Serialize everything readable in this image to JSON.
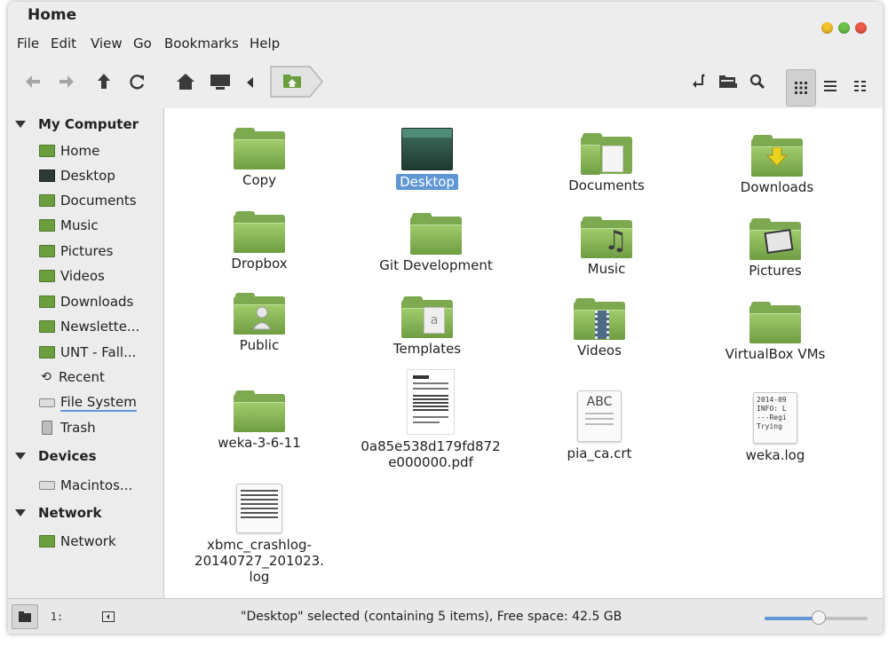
{
  "window": {
    "title": "Home"
  },
  "menu": [
    "File",
    "Edit",
    "View",
    "Go",
    "Bookmarks",
    "Help"
  ],
  "toolbar": {
    "nav_icons": [
      "back-arrow-icon",
      "forward-arrow-icon",
      "up-arrow-icon",
      "reload-icon"
    ],
    "place_icons": [
      "home-icon",
      "computer-icon"
    ],
    "breadcrumb_icon": "home-folder-icon",
    "right_icons": [
      "open-terminal-icon",
      "new-folder-icon",
      "search-icon"
    ],
    "view_icons": [
      "icon-view-icon",
      "list-view-icon",
      "compact-view-icon"
    ]
  },
  "sidebar": {
    "sections": [
      {
        "label": "My Computer",
        "items": [
          {
            "label": "Home",
            "icon": "home-folder-icon"
          },
          {
            "label": "Desktop",
            "icon": "desktop-icon"
          },
          {
            "label": "Documents",
            "icon": "folder-icon"
          },
          {
            "label": "Music",
            "icon": "folder-icon"
          },
          {
            "label": "Pictures",
            "icon": "folder-icon"
          },
          {
            "label": "Videos",
            "icon": "folder-icon"
          },
          {
            "label": "Downloads",
            "icon": "folder-icon"
          },
          {
            "label": "Newslette...",
            "icon": "folder-icon"
          },
          {
            "label": "UNT - Fall...",
            "icon": "folder-icon"
          },
          {
            "label": "Recent",
            "icon": "recent-icon"
          },
          {
            "label": "File System",
            "icon": "drive-icon"
          },
          {
            "label": "Trash",
            "icon": "trash-icon"
          }
        ]
      },
      {
        "label": "Devices",
        "items": [
          {
            "label": "Macintos...",
            "icon": "drive-icon"
          }
        ]
      },
      {
        "label": "Network",
        "items": [
          {
            "label": "Network",
            "icon": "network-icon"
          }
        ]
      }
    ]
  },
  "files": [
    {
      "name": "Copy",
      "type": "folder"
    },
    {
      "name": "Desktop",
      "type": "desktop",
      "selected": true
    },
    {
      "name": "Documents",
      "type": "folder",
      "emblem": "document"
    },
    {
      "name": "Downloads",
      "type": "folder",
      "emblem": "download"
    },
    {
      "name": "Dropbox",
      "type": "folder"
    },
    {
      "name": "Git Development",
      "type": "folder"
    },
    {
      "name": "Music",
      "type": "folder",
      "emblem": "music"
    },
    {
      "name": "Pictures",
      "type": "folder",
      "emblem": "pictures"
    },
    {
      "name": "Public",
      "type": "folder",
      "emblem": "person"
    },
    {
      "name": "Templates",
      "type": "folder",
      "emblem": "template"
    },
    {
      "name": "Videos",
      "type": "folder",
      "emblem": "film"
    },
    {
      "name": "VirtualBox VMs",
      "type": "folder"
    },
    {
      "name": "weka-3-6-11",
      "type": "folder"
    },
    {
      "name": "0a85e538d179fd872\ne000000.pdf",
      "type": "pdf"
    },
    {
      "name": "pia_ca.crt",
      "type": "text",
      "preview": "ABC"
    },
    {
      "name": "weka.log",
      "type": "log",
      "preview": "2014-09\nINFO: L\n---Regi\nTrying"
    },
    {
      "name": "xbmc_crashlog-\n20140727_201023.\nlog",
      "type": "log2"
    }
  ],
  "status": {
    "text": "\"Desktop\" selected (containing 5 items), Free space: 42.5 GB",
    "zoom_fraction": 0.53
  },
  "statusbar_icons": [
    "places-icon",
    "treeview-icon",
    "hide-sidebar-icon"
  ],
  "colors": {
    "selection": "#5f97d5",
    "folder": "#7daa50"
  }
}
